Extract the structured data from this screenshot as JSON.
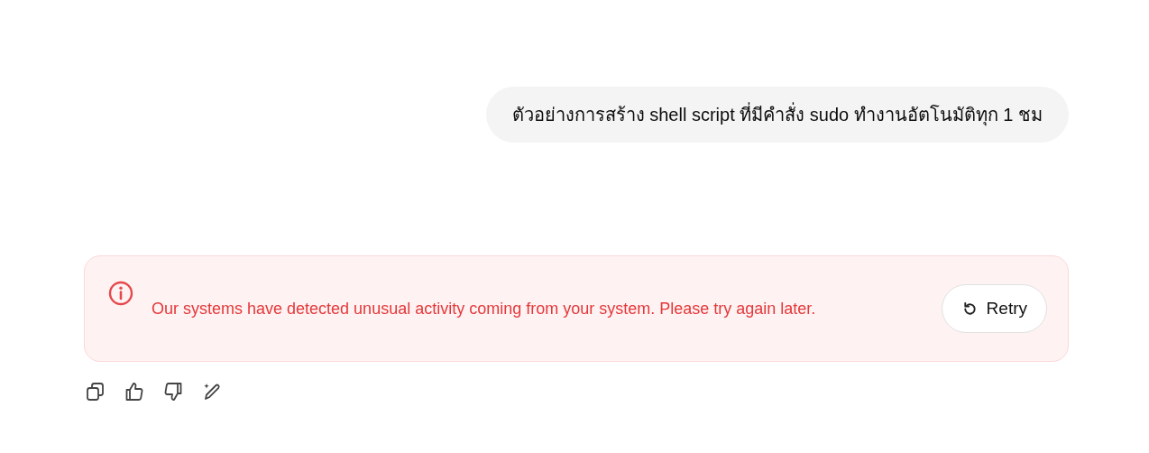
{
  "user_message": "ตัวอย่างการสร้าง shell script ที่มีคำสั่ง sudo ทำงานอัตโนมัติทุก 1 ชม",
  "error": {
    "message": "Our systems have detected unusual activity coming from your system. Please try again later.",
    "retry_button": "Retry"
  }
}
